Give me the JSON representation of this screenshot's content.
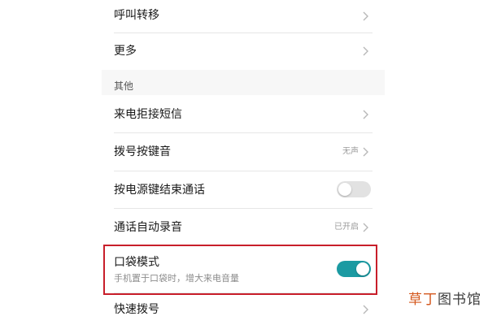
{
  "settings": {
    "call_forwarding": {
      "label": "呼叫转移"
    },
    "more": {
      "label": "更多"
    },
    "section_other": {
      "title": "其他"
    },
    "reject_sms": {
      "label": "来电拒接短信"
    },
    "dial_tone": {
      "label": "拨号按键音",
      "value": "无声"
    },
    "power_end_call": {
      "label": "按电源键结束通话",
      "toggle": "off"
    },
    "auto_record": {
      "label": "通话自动录音",
      "value": "已开启"
    },
    "pocket_mode": {
      "label": "口袋模式",
      "description": "手机置于口袋时，增大来电音量",
      "toggle": "on"
    },
    "speed_dial": {
      "label": "快速拨号"
    }
  },
  "colors": {
    "toggle_on": "#1b9aa2",
    "toggle_off": "#e2e2e2",
    "highlight": "#c81e2a"
  },
  "icons": [
    "chevron-right-icon"
  ],
  "watermark": {
    "part1": "草丁",
    "part2": "图书馆"
  }
}
